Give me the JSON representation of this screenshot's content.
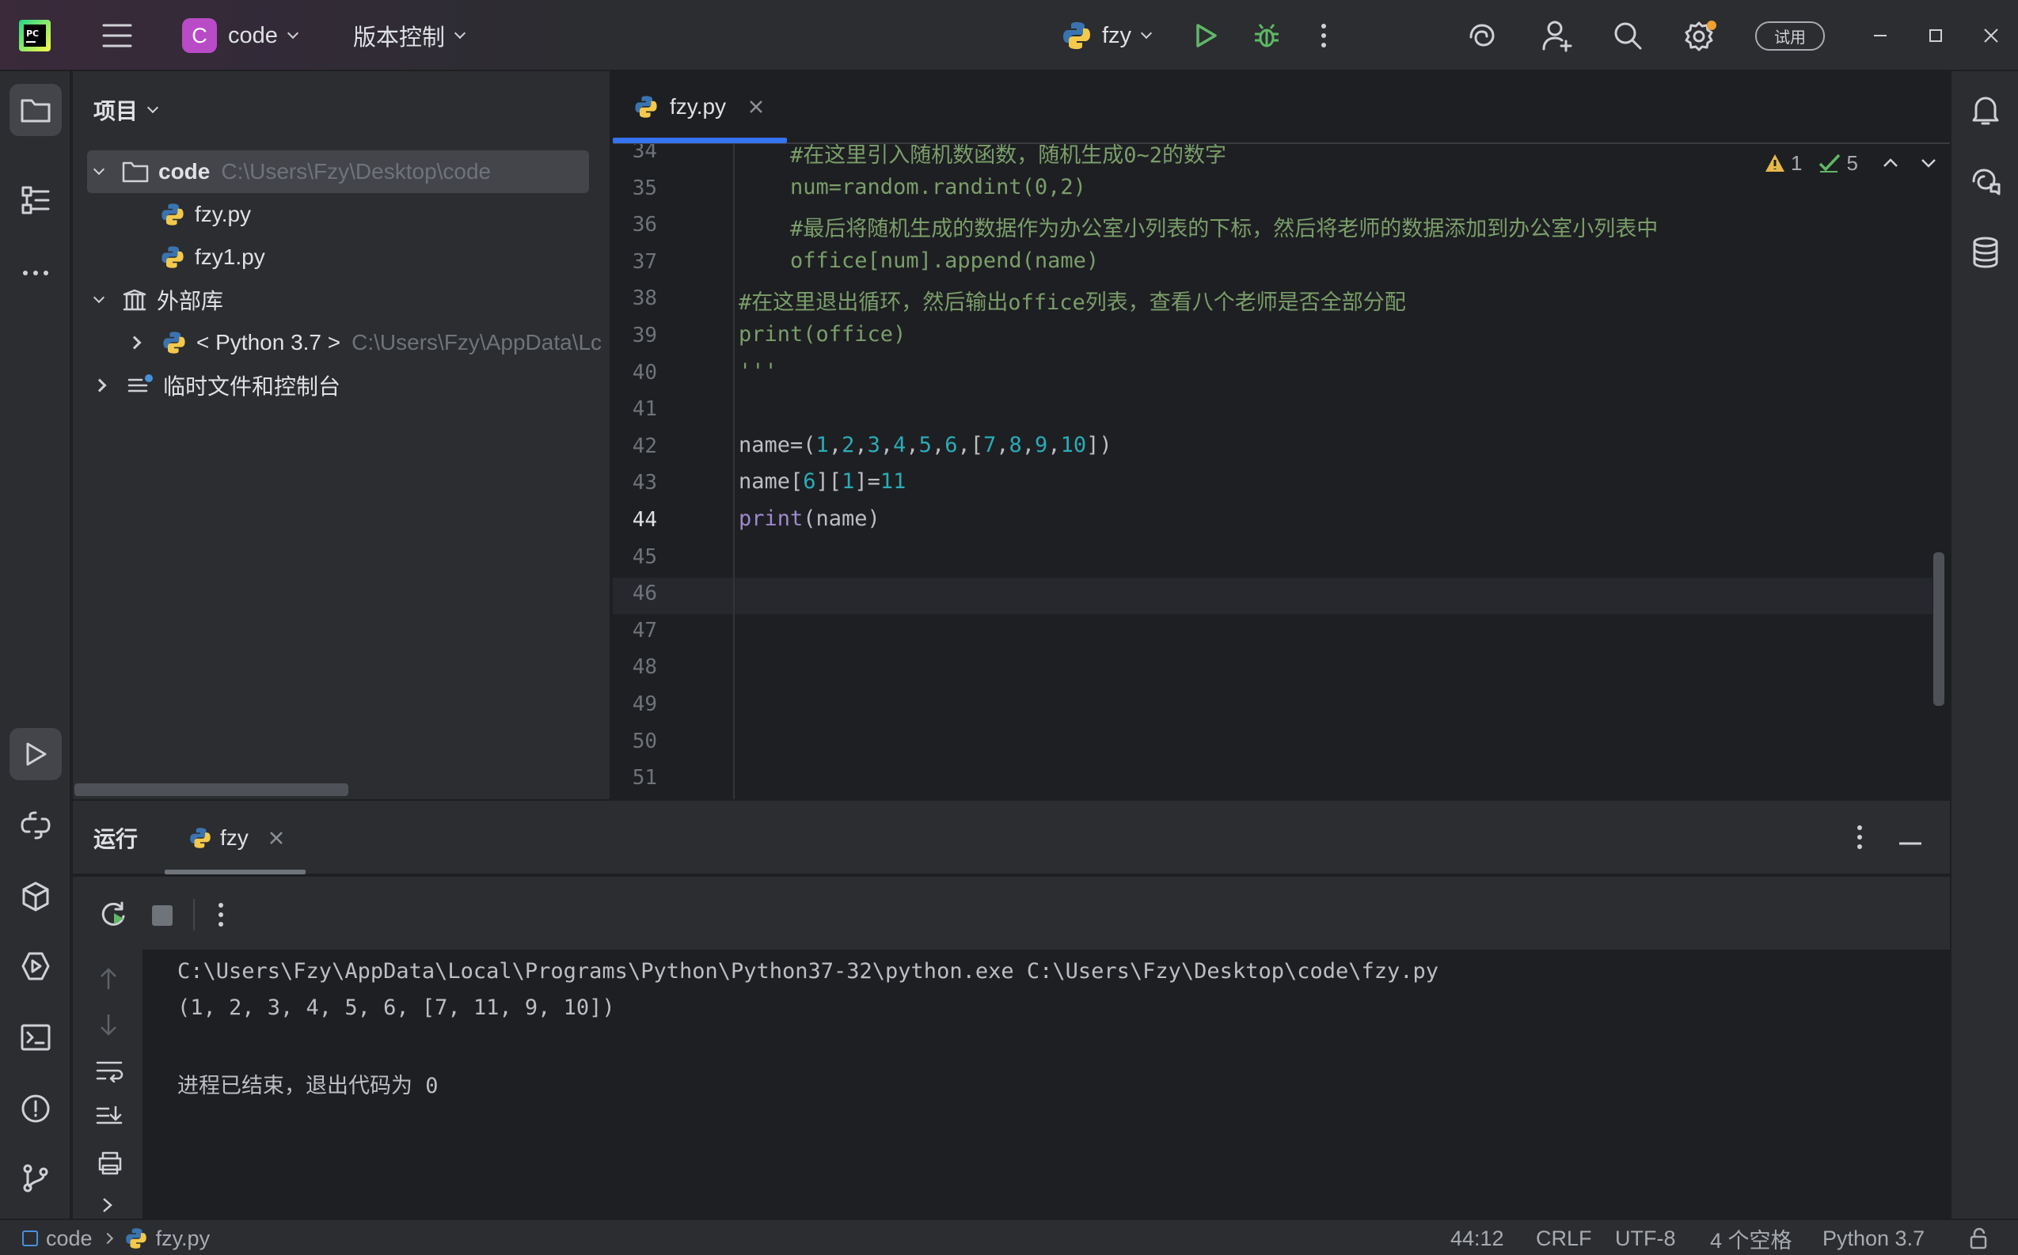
{
  "titlebar": {
    "project_badge": "C",
    "project_name": "code",
    "vcs_label": "版本控制",
    "run_config": "fzy",
    "trial_label": "试用",
    "colors": {
      "badge": "#b94bc7",
      "run": "#5fb865",
      "debug": "#5fb865",
      "notify_dot": "#f0a030"
    }
  },
  "project_panel": {
    "title": "项目",
    "tree": {
      "root_name": "code",
      "root_path": "C:\\Users\\Fzy\\Desktop\\code",
      "files": [
        "fzy.py",
        "fzy1.py"
      ],
      "external_libs": "外部库",
      "python_sdk": "< Python 3.7 >",
      "python_path": "C:\\Users\\Fzy\\AppData\\Lc",
      "scratches": "临时文件和控制台"
    }
  },
  "editor": {
    "tab_label": "fzy.py",
    "inspections": {
      "warnings": "1",
      "ok": "5"
    },
    "lines": [
      {
        "num": "34",
        "text": "    #在这里引入随机数函数，随机生成0~2的数字",
        "kind": "comment"
      },
      {
        "num": "35",
        "text": "    num=random.randint(0,2)",
        "kind": "comment"
      },
      {
        "num": "36",
        "text": "    #最后将随机生成的数据作为办公室小列表的下标，然后将老师的数据添加到办公室小列表中",
        "kind": "comment"
      },
      {
        "num": "37",
        "text": "    office[num].append(name)",
        "kind": "comment"
      },
      {
        "num": "38",
        "text": "#在这里退出循环，然后输出office列表，查看八个老师是否全部分配",
        "kind": "comment"
      },
      {
        "num": "39",
        "text": "print(office)",
        "kind": "comment"
      },
      {
        "num": "40",
        "text": "'''",
        "kind": "comment"
      },
      {
        "num": "41",
        "text": "",
        "kind": "plain"
      },
      {
        "num": "42",
        "text": "name=(1,2,3,4,5,6,[7,8,9,10])",
        "kind": "code"
      },
      {
        "num": "43",
        "text": "name[6][1]=11",
        "kind": "code"
      },
      {
        "num": "44",
        "text": "print(name)",
        "kind": "code"
      },
      {
        "num": "45",
        "text": "",
        "kind": "plain"
      },
      {
        "num": "46",
        "text": "",
        "kind": "plain"
      },
      {
        "num": "47",
        "text": "",
        "kind": "plain"
      },
      {
        "num": "48",
        "text": "",
        "kind": "plain"
      },
      {
        "num": "49",
        "text": "",
        "kind": "plain"
      },
      {
        "num": "50",
        "text": "",
        "kind": "plain"
      },
      {
        "num": "51",
        "text": "",
        "kind": "plain"
      }
    ],
    "current_line": "44"
  },
  "run_panel": {
    "title": "运行",
    "tab_label": "fzy",
    "output": [
      "C:\\Users\\Fzy\\AppData\\Local\\Programs\\Python\\Python37-32\\python.exe C:\\Users\\Fzy\\Desktop\\code\\fzy.py",
      "(1, 2, 3, 4, 5, 6, [7, 11, 9, 10])",
      "",
      "进程已结束，退出代码为 0"
    ]
  },
  "statusbar": {
    "breadcrumb_project": "code",
    "breadcrumb_file": "fzy.py",
    "position": "44:12",
    "line_sep": "CRLF",
    "encoding": "UTF-8",
    "indent": "4 个空格",
    "interpreter": "Python 3.7"
  }
}
